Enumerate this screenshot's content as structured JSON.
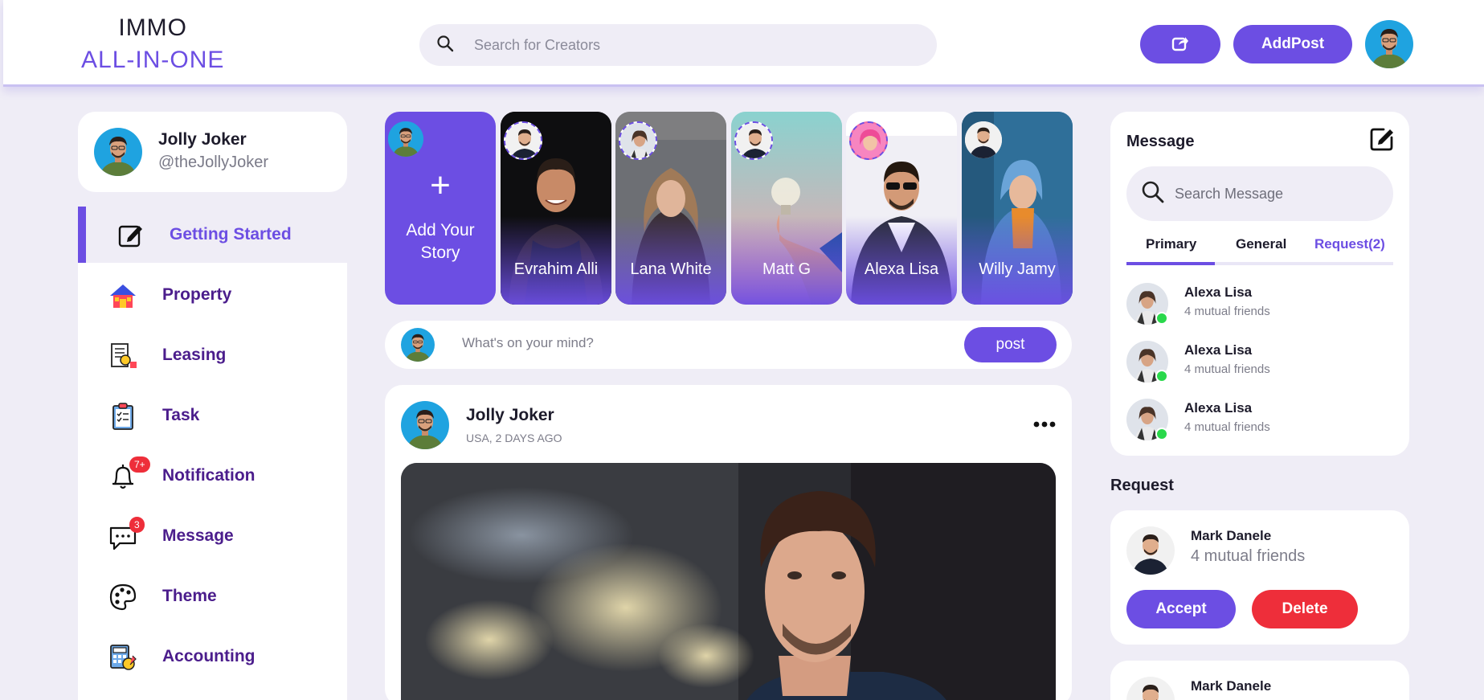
{
  "brand": {
    "line1": "IMMO",
    "line2": "ALL-IN-ONE"
  },
  "header": {
    "search_placeholder": "Search for Creators",
    "addpost_label": "AddPost",
    "share_icon": "share-icon"
  },
  "profile": {
    "name": "Jolly Joker",
    "handle": "@theJollyJoker"
  },
  "menu": [
    {
      "label": "Getting Started",
      "icon": "edit-icon"
    },
    {
      "label": "Property",
      "icon": "house-icon"
    },
    {
      "label": "Leasing",
      "icon": "document-icon"
    },
    {
      "label": "Task",
      "icon": "clipboard-icon"
    },
    {
      "label": "Notification",
      "icon": "bell-icon",
      "badge": "7+"
    },
    {
      "label": "Message",
      "icon": "chat-icon",
      "badge": "3"
    },
    {
      "label": "Theme",
      "icon": "palette-icon"
    },
    {
      "label": "Accounting",
      "icon": "calculator-icon"
    }
  ],
  "stories": {
    "add_plus": "+",
    "add_label_1": "Add Your",
    "add_label_2": "Story",
    "items": [
      {
        "name": "Evrahim Alli"
      },
      {
        "name": "Lana White"
      },
      {
        "name": "Matt G"
      },
      {
        "name": "Alexa Lisa"
      },
      {
        "name": "Willy Jamy"
      }
    ]
  },
  "compose": {
    "placeholder": "What's on your mind?",
    "post_label": "post"
  },
  "feed": {
    "author": "Jolly Joker",
    "meta": "USA, 2 DAYS AGO"
  },
  "messages": {
    "title": "Message",
    "search_placeholder": "Search Message",
    "tabs": {
      "primary": "Primary",
      "general": "General",
      "request": "Request(2)"
    },
    "friends": [
      {
        "name": "Alexa Lisa",
        "mutual": "4 mutual friends"
      },
      {
        "name": "Alexa Lisa",
        "mutual": "4 mutual friends"
      },
      {
        "name": "Alexa Lisa",
        "mutual": "4 mutual friends"
      }
    ]
  },
  "requests": {
    "title": "Request",
    "items": [
      {
        "name": "Mark Danele",
        "mutual": "4 mutual friends",
        "accept": "Accept",
        "delete": "Delete"
      },
      {
        "name": "Mark Danele"
      }
    ]
  },
  "colors": {
    "accent": "#6c4ee3",
    "danger": "#ee2e3a",
    "online": "#29d84b",
    "menu_text": "#4b1d8c",
    "background": "#efedf6"
  }
}
